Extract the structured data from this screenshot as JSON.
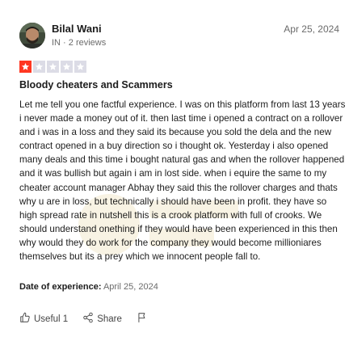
{
  "review": {
    "author": {
      "name": "Bilal Wani",
      "meta": "IN · 2 reviews"
    },
    "date": "Apr 25, 2024",
    "rating": 1,
    "rating_color": "#ff3722",
    "title": "Bloody cheaters and Scammers",
    "body": "Let me tell you one factful experience. I was on this platform from last 13 years i never made a money out of it. then last time i opened a contract on a rollover and i was in a loss and they said its because you sold the dela and the new contract opened in a buy direction so i thought ok. Yesterday i also opened many deals and this time i bought natural gas and when the rollover happened and it was bullish but again i am in lost side. when i equire the same to my cheater account manager Abhay they said this the rollover charges and thats why u are in loss, but technically i should have been in profit. they have so high spread rate in nutshell this is a crook platform with full of crooks. We should understand onething if they would have been experienced in this then why would they do work for the company they would become millioniares themselves but its a prey which we innocent people fall to.",
    "date_of_experience_label": "Date of experience:",
    "date_of_experience_value": "April 25, 2024"
  },
  "actions": {
    "useful_label": "Useful 1",
    "share_label": "Share"
  },
  "icons": [
    "thumbs-up-icon",
    "share-icon",
    "flag-icon",
    "star-icon"
  ]
}
